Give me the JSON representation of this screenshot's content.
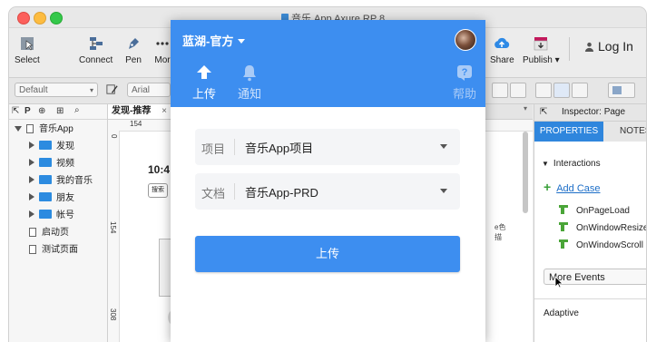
{
  "window": {
    "title": "音乐 App  Axure RP 8"
  },
  "toolbar": {
    "select": "Select",
    "connect": "Connect",
    "pen": "Pen",
    "more": "Mor",
    "share": "Share",
    "publish": "Publish ▾",
    "login": "Log In"
  },
  "format_bar": {
    "style_select": "Default",
    "font_select": "Arial"
  },
  "pages_panel": {
    "header": "P",
    "items": [
      {
        "label": "音乐App",
        "type": "page",
        "expanded": true
      },
      {
        "label": "发现",
        "type": "folder"
      },
      {
        "label": "视频",
        "type": "folder"
      },
      {
        "label": "我的音乐",
        "type": "folder"
      },
      {
        "label": "朋友",
        "type": "folder"
      },
      {
        "label": "帐号",
        "type": "folder"
      },
      {
        "label": "启动页",
        "type": "page"
      },
      {
        "label": "测试页面",
        "type": "page"
      }
    ]
  },
  "canvas": {
    "tab_label": "发现-推荐",
    "ruler_h": "154",
    "ruler_v": [
      "0",
      "154",
      "308"
    ],
    "mock_time": "10:4",
    "mock_search": "搜索",
    "side_text": [
      "e色",
      "描"
    ]
  },
  "inspector": {
    "header": "Inspector: Page",
    "tab_properties": "PROPERTIES",
    "tab_notes": "NOTES",
    "interactions_label": "Interactions",
    "add_case": "Add Case",
    "events": [
      "OnPageLoad",
      "OnWindowResize",
      "OnWindowScroll"
    ],
    "more_events": "More Events",
    "adaptive": "Adaptive"
  },
  "popup": {
    "team": "蓝湖-官方",
    "nav": [
      {
        "label": "上传",
        "active": true
      },
      {
        "label": "通知",
        "active": false
      },
      {
        "label": "帮助",
        "active": false
      }
    ],
    "project_label": "项目",
    "project_value": "音乐App项目",
    "doc_label": "文档",
    "doc_value": "音乐App-PRD",
    "upload_button": "上传"
  },
  "colors": {
    "popup_accent": "#3d8ef0",
    "inspector_tab_active": "#2f86dd",
    "folder_blue": "#2c8be0"
  }
}
